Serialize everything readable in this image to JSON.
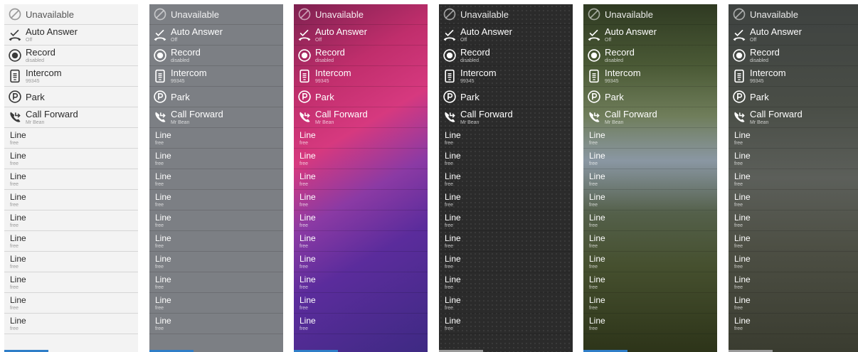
{
  "items": {
    "unavailable": {
      "title": "Unavailable"
    },
    "auto_answer": {
      "title": "Auto Answer",
      "sub": "Off"
    },
    "record": {
      "title": "Record",
      "sub": "disabled"
    },
    "intercom": {
      "title": "Intercom",
      "sub": "99345"
    },
    "park": {
      "title": "Park"
    },
    "call_forward": {
      "title": "Call Forward",
      "sub": "Mr Bean"
    }
  },
  "lines": [
    {
      "title": "Line",
      "sub": "free"
    },
    {
      "title": "Line",
      "sub": "free"
    },
    {
      "title": "Line",
      "sub": "free"
    },
    {
      "title": "Line",
      "sub": "free"
    },
    {
      "title": "Line",
      "sub": "free"
    },
    {
      "title": "Line",
      "sub": "free"
    },
    {
      "title": "Line",
      "sub": "free"
    },
    {
      "title": "Line",
      "sub": "free"
    },
    {
      "title": "Line",
      "sub": "free"
    },
    {
      "title": "Line",
      "sub": "free"
    }
  ],
  "panels": [
    {
      "theme": "light",
      "background": "#f3f3f3"
    },
    {
      "theme": "grey",
      "background": "#7c7f84"
    },
    {
      "theme": "magenta-purple",
      "background": "#c02e6c"
    },
    {
      "theme": "dark-dots",
      "background": "#2b2b2b"
    },
    {
      "theme": "landscape",
      "background": "#54604a"
    },
    {
      "theme": "dim-landscape",
      "background": "#4a4e47"
    }
  ],
  "icons": {
    "unavailable": "block-icon",
    "auto_answer": "auto-answer-icon",
    "record": "record-icon",
    "intercom": "intercom-icon",
    "park": "park-icon",
    "call_forward": "call-forward-icon"
  },
  "colors": {
    "accent": "#2f7ec8"
  }
}
